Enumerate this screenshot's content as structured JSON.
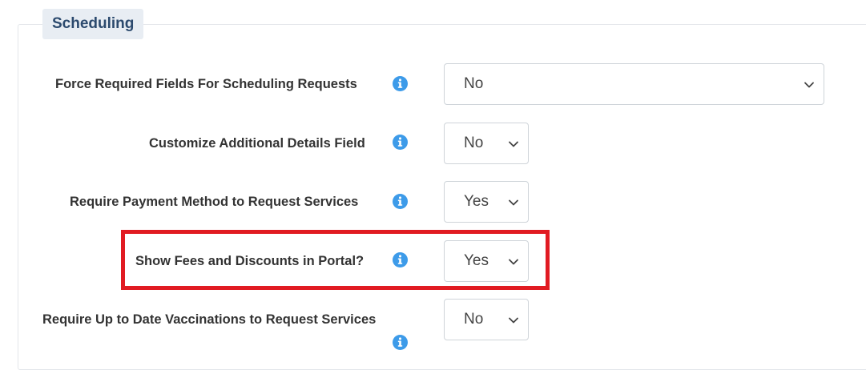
{
  "section": {
    "title": "Scheduling"
  },
  "settings": [
    {
      "label": "Force Required Fields For Scheduling Requests",
      "value": "No"
    },
    {
      "label": "Customize Additional Details Field",
      "value": "No"
    },
    {
      "label": "Require Payment Method to Request Services",
      "value": "Yes"
    },
    {
      "label": "Show Fees and Discounts in Portal?",
      "value": "Yes"
    },
    {
      "label": "Require Up to Date Vaccinations to Request Services",
      "value": "No"
    }
  ],
  "colors": {
    "info_icon": "#3d9be9",
    "highlight_border": "#e11b22",
    "legend_bg": "#e8edf3",
    "legend_text": "#2c4a6e"
  },
  "icons": {
    "info": "info-icon",
    "dropdown": "chevron-down-icon"
  }
}
